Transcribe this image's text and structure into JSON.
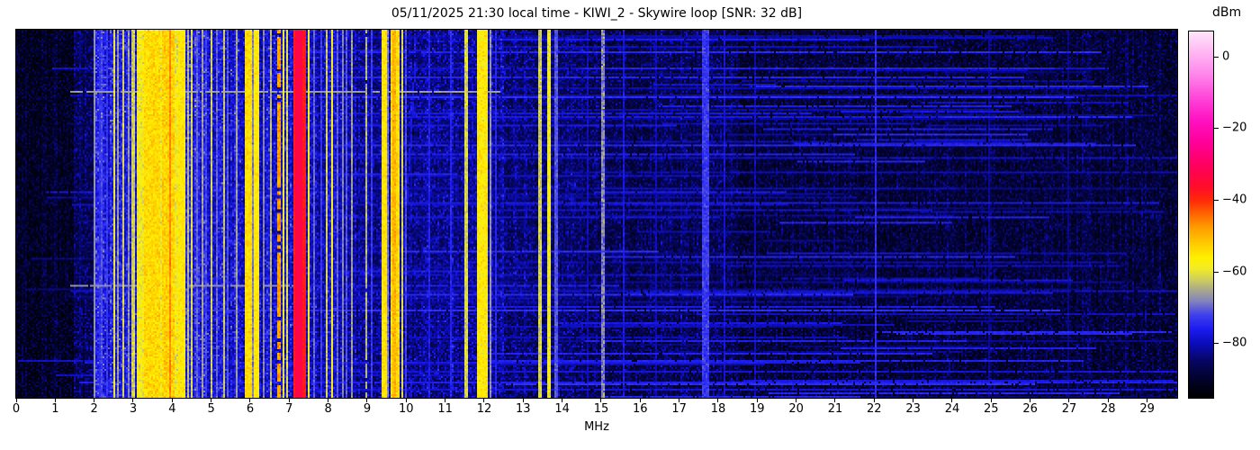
{
  "header": {
    "title": "05/11/2025 21:30 local time - KIWI_2 - Skywire loop [SNR: 32 dB]"
  },
  "chart_data": {
    "type": "heatmap",
    "title": "05/11/2025 21:30 local time - KIWI_2 - Skywire loop [SNR: 32 dB]",
    "xlabel": "MHz",
    "x_ticks": [
      0,
      1,
      2,
      3,
      4,
      5,
      6,
      7,
      8,
      9,
      10,
      11,
      12,
      13,
      14,
      15,
      16,
      17,
      18,
      19,
      20,
      21,
      22,
      23,
      24,
      25,
      26,
      27,
      28,
      29
    ],
    "x_range": [
      0,
      29.77
    ],
    "grid": false,
    "colorbar": {
      "label": "dBm",
      "ticks": [
        0,
        -20,
        -40,
        -60,
        -80
      ],
      "range": [
        -95,
        7
      ]
    },
    "colormap_stops": [
      [
        -95,
        0,
        0,
        0
      ],
      [
        -90,
        2,
        2,
        42
      ],
      [
        -85,
        6,
        6,
        95
      ],
      [
        -80,
        12,
        12,
        185
      ],
      [
        -76,
        28,
        28,
        238
      ],
      [
        -72,
        64,
        64,
        238
      ],
      [
        -68,
        132,
        132,
        188
      ],
      [
        -65,
        168,
        168,
        142
      ],
      [
        -62,
        208,
        208,
        92
      ],
      [
        -59,
        242,
        236,
        40
      ],
      [
        -56,
        255,
        240,
        0
      ],
      [
        -52,
        255,
        202,
        0
      ],
      [
        -48,
        255,
        162,
        0
      ],
      [
        -44,
        255,
        104,
        0
      ],
      [
        -40,
        255,
        42,
        8
      ],
      [
        -36,
        255,
        12,
        44
      ],
      [
        -30,
        255,
        0,
        96
      ],
      [
        -24,
        255,
        0,
        152
      ],
      [
        -18,
        255,
        16,
        192
      ],
      [
        -12,
        255,
        64,
        216
      ],
      [
        -6,
        255,
        124,
        232
      ],
      [
        0,
        255,
        172,
        242
      ],
      [
        7,
        255,
        228,
        250
      ]
    ],
    "noise_regions_format": "[f0_MHz, f1_MHz, floor_dBm, speckle_dB, stripe_dB]",
    "noise_regions": [
      [
        0.0,
        1.45,
        -93,
        1.5,
        0.5
      ],
      [
        1.45,
        1.95,
        -88,
        3,
        1.5
      ],
      [
        1.95,
        5.75,
        -80,
        4.5,
        3
      ],
      [
        5.75,
        7.6,
        -82,
        4.5,
        2.5
      ],
      [
        7.6,
        8.7,
        -83,
        4,
        2
      ],
      [
        8.7,
        9.3,
        -86,
        3.5,
        1.5
      ],
      [
        9.3,
        12.6,
        -85,
        4,
        2
      ],
      [
        12.6,
        14.5,
        -87,
        3.5,
        1.5
      ],
      [
        14.5,
        18.5,
        -89,
        3.5,
        1
      ],
      [
        18.5,
        29.8,
        -91,
        3,
        0.8
      ]
    ],
    "bands_format": "[f0_MHz, f1_MHz, level_dBm, variance_dB, dashed_0or1, duty]",
    "bands": [
      [
        1.98,
        2.03,
        -67,
        2,
        0,
        1
      ],
      [
        2.08,
        2.13,
        -74,
        3,
        0,
        1
      ],
      [
        2.15,
        2.2,
        -72,
        3,
        0,
        1
      ],
      [
        2.28,
        2.33,
        -73,
        3,
        0,
        1
      ],
      [
        2.47,
        2.52,
        -60,
        4,
        1,
        0.7
      ],
      [
        2.58,
        2.63,
        -66,
        4,
        1,
        0.6
      ],
      [
        2.7,
        2.75,
        -62,
        4,
        1,
        0.65
      ],
      [
        2.83,
        2.88,
        -67,
        4,
        1,
        0.6
      ],
      [
        2.94,
        3.04,
        -62,
        5,
        1,
        0.7
      ],
      [
        3.05,
        4.28,
        -58,
        7,
        0,
        1
      ],
      [
        3.25,
        3.68,
        -54,
        6,
        0,
        1
      ],
      [
        3.72,
        4.02,
        -53,
        6,
        0,
        1
      ],
      [
        3.9,
        3.95,
        -46,
        3,
        0,
        1
      ],
      [
        4.15,
        4.3,
        -56,
        5,
        0,
        1
      ],
      [
        4.37,
        4.42,
        -64,
        4,
        1,
        0.6
      ],
      [
        4.46,
        4.51,
        -61,
        4,
        1,
        0.6
      ],
      [
        4.6,
        4.65,
        -70,
        3,
        0,
        1
      ],
      [
        4.74,
        4.79,
        -66,
        4,
        1,
        0.55
      ],
      [
        4.84,
        4.89,
        -72,
        3,
        0,
        1
      ],
      [
        4.98,
        5.03,
        -62,
        4,
        1,
        0.6
      ],
      [
        5.11,
        5.16,
        -70,
        3,
        0,
        1
      ],
      [
        5.27,
        5.32,
        -63,
        4,
        1,
        0.6
      ],
      [
        5.39,
        5.44,
        -71,
        3,
        0,
        1
      ],
      [
        5.59,
        5.64,
        -66,
        4,
        1,
        0.5
      ],
      [
        5.83,
        6.03,
        -54,
        5,
        0,
        1
      ],
      [
        6.03,
        6.08,
        -68,
        4,
        0,
        1
      ],
      [
        6.08,
        6.22,
        -56,
        5,
        0,
        1
      ],
      [
        6.29,
        6.34,
        -68,
        3,
        1,
        0.5
      ],
      [
        6.48,
        6.53,
        -64,
        4,
        1,
        0.5
      ],
      [
        6.68,
        6.74,
        -48,
        6,
        1,
        0.3
      ],
      [
        6.8,
        6.86,
        -58,
        5,
        1,
        0.5
      ],
      [
        6.9,
        6.96,
        -61,
        5,
        1,
        0.5
      ],
      [
        7.1,
        7.42,
        -38,
        3,
        0,
        1
      ],
      [
        7.15,
        7.33,
        -33,
        2,
        0,
        1
      ],
      [
        7.44,
        7.5,
        -57,
        4,
        1,
        0.75
      ],
      [
        7.6,
        7.65,
        -70,
        3,
        0,
        1
      ],
      [
        7.78,
        7.83,
        -73,
        3,
        0,
        1
      ],
      [
        7.93,
        7.98,
        -62,
        4,
        1,
        0.5
      ],
      [
        8.06,
        8.12,
        -58,
        4,
        1,
        0.8
      ],
      [
        8.2,
        8.25,
        -70,
        3,
        0,
        1
      ],
      [
        8.34,
        8.39,
        -68,
        3,
        0,
        1
      ],
      [
        8.44,
        8.49,
        -71,
        3,
        0,
        1
      ],
      [
        8.56,
        8.61,
        -66,
        4,
        1,
        0.5
      ],
      [
        8.95,
        9.0,
        -64,
        4,
        1,
        0.45
      ],
      [
        9.06,
        9.11,
        -73,
        3,
        0,
        1
      ],
      [
        9.33,
        9.5,
        -55,
        5,
        0,
        1
      ],
      [
        9.5,
        9.55,
        -68,
        4,
        0,
        1
      ],
      [
        9.57,
        9.8,
        -54,
        6,
        0,
        1
      ],
      [
        9.63,
        9.73,
        -50,
        5,
        0,
        1
      ],
      [
        9.84,
        9.89,
        -61,
        4,
        1,
        0.5
      ],
      [
        9.96,
        10.01,
        -72,
        3,
        0,
        1
      ],
      [
        10.53,
        10.58,
        -76,
        3,
        0,
        1
      ],
      [
        11.08,
        11.13,
        -75,
        3,
        0,
        1
      ],
      [
        11.48,
        11.58,
        -61,
        5,
        1,
        0.55
      ],
      [
        11.8,
        12.06,
        -56,
        6,
        1,
        0.8
      ],
      [
        12.1,
        12.15,
        -67,
        3,
        0,
        1
      ],
      [
        12.24,
        12.29,
        -75,
        3,
        0,
        1
      ],
      [
        13.35,
        13.45,
        -62,
        5,
        1,
        0.5
      ],
      [
        13.57,
        13.68,
        -59,
        5,
        1,
        0.55
      ],
      [
        13.8,
        13.85,
        -71,
        3,
        0,
        1
      ],
      [
        14.6,
        14.65,
        -80,
        3,
        0,
        1
      ],
      [
        14.96,
        15.06,
        -68,
        7,
        1,
        0.8
      ],
      [
        15.55,
        15.6,
        -77,
        3,
        0,
        1
      ],
      [
        16.35,
        16.4,
        -80,
        3,
        0,
        1
      ],
      [
        17.56,
        17.74,
        -73,
        4,
        0,
        1
      ],
      [
        18.1,
        18.15,
        -78,
        3,
        0,
        1
      ],
      [
        18.9,
        18.95,
        -80,
        3,
        0,
        1
      ],
      [
        21.97,
        22.03,
        -74,
        3,
        0,
        1
      ],
      [
        24.88,
        24.93,
        -82,
        2,
        0,
        1
      ],
      [
        26.95,
        27.0,
        -83,
        2,
        0,
        1
      ]
    ],
    "strong_bursts_format": "[y_frac, f0_MHz, f1_MHz, level_dBm]",
    "strong_bursts": [
      [
        0.164,
        1.4,
        12.4,
        -66
      ],
      [
        0.176,
        1.4,
        29.8,
        -80
      ],
      [
        0.347,
        8.5,
        29.8,
        -79
      ],
      [
        0.384,
        14.0,
        29.8,
        -80
      ],
      [
        0.694,
        1.4,
        7.3,
        -67
      ],
      [
        0.706,
        1.4,
        29.8,
        -79
      ],
      [
        0.929,
        6.0,
        29.8,
        -78
      ],
      [
        0.958,
        1.6,
        29.8,
        -76
      ],
      [
        0.978,
        4.0,
        29.8,
        -78
      ]
    ],
    "random_bursts": {
      "count": 130,
      "level_min": -85,
      "level_max": -74
    },
    "chirp": {
      "f_start": 10.22,
      "f_end": 9.88,
      "y0_frac": 0.0,
      "y1_frac": 0.62,
      "level": -77
    },
    "seed": 12345
  }
}
